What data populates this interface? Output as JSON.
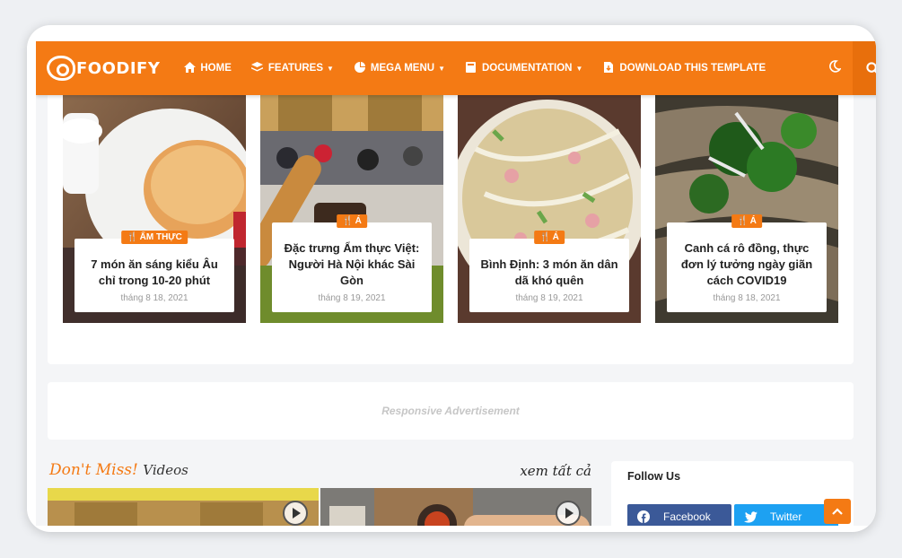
{
  "header": {
    "logo_text": "FOODIFY",
    "menu": [
      {
        "label": "HOME",
        "icon": "home-icon"
      },
      {
        "label": "FEATURES",
        "icon": "layers-icon",
        "dropdown": true
      },
      {
        "label": "MEGA MENU",
        "icon": "pie-icon",
        "dropdown": true
      },
      {
        "label": "DOCUMENTATION",
        "icon": "book-icon",
        "dropdown": true
      },
      {
        "label": "DOWNLOAD THIS TEMPLATE",
        "icon": "file-download-icon"
      }
    ],
    "accent_color": "#f47a14"
  },
  "featured": [
    {
      "category": "ẨM THỰC",
      "title": "7 món ăn sáng kiểu Âu chỉ trong 10-20 phút",
      "date": "tháng 8 18, 2021"
    },
    {
      "category": "Á",
      "title": "Đặc trưng Ẩm thực Việt: Người Hà Nội khác Sài Gòn",
      "date": "tháng 8 19, 2021"
    },
    {
      "category": "Á",
      "title": "Bình Định: 3 món ăn dân dã khó quên",
      "date": "tháng 8 19, 2021"
    },
    {
      "category": "Á",
      "title": "Canh cá rô đồng, thực đơn lý tưởng ngày giãn cách COVID19",
      "date": "tháng 8 18, 2021"
    }
  ],
  "ad": {
    "text": "Responsive Advertisement"
  },
  "dont_miss": {
    "title": "Don't Miss!",
    "subtitle": "Videos",
    "view_all": "xem tất cả"
  },
  "follow": {
    "title": "Follow Us",
    "buttons": [
      {
        "label": "Facebook",
        "color": "#3b5998",
        "icon": "facebook-icon"
      },
      {
        "label": "Twitter",
        "color": "#1da1f2",
        "icon": "twitter-icon"
      }
    ]
  }
}
